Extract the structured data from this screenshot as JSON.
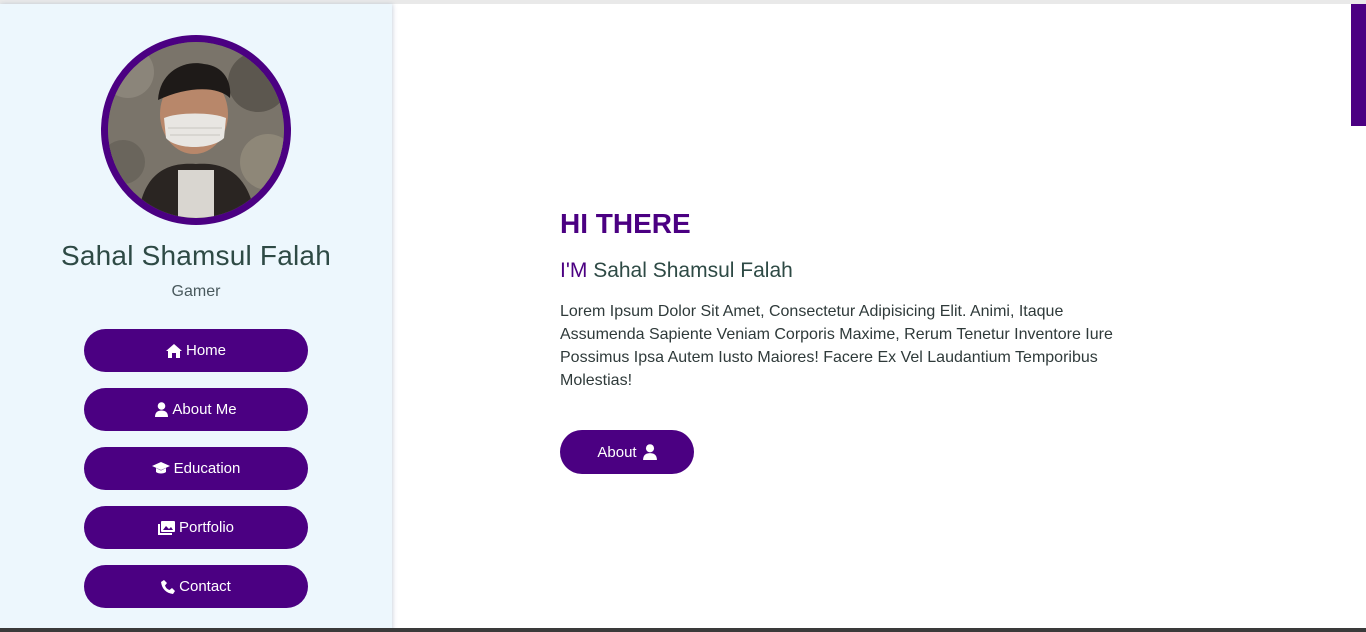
{
  "profile": {
    "name": "Sahal Shamsul Falah",
    "role": "Gamer"
  },
  "nav": {
    "home": "Home",
    "about": "About Me",
    "education": "Education",
    "portfolio": "Portfolio",
    "contact": "Contact"
  },
  "hero": {
    "greeting": "HI THERE",
    "intro_prefix": "I'M",
    "intro_name": "Sahal Shamsul Falah",
    "text": "Lorem Ipsum Dolor Sit Amet, Consectetur Adipisicing Elit. Animi, Itaque Assumenda Sapiente Veniam Corporis Maxime, Rerum Tenetur Inventore Iure Possimus Ipsa Autem Iusto Maiores! Facere Ex Vel Laudantium Temporibus Molestias!",
    "button": "About"
  },
  "icons": {
    "home": "home-icon",
    "about": "user-icon",
    "education": "graduation-cap-icon",
    "portfolio": "images-icon",
    "contact": "phone-icon"
  },
  "colors": {
    "accent": "#4b0082",
    "sidebar_bg": "#edf7fd",
    "name_text": "#2e4a45"
  }
}
